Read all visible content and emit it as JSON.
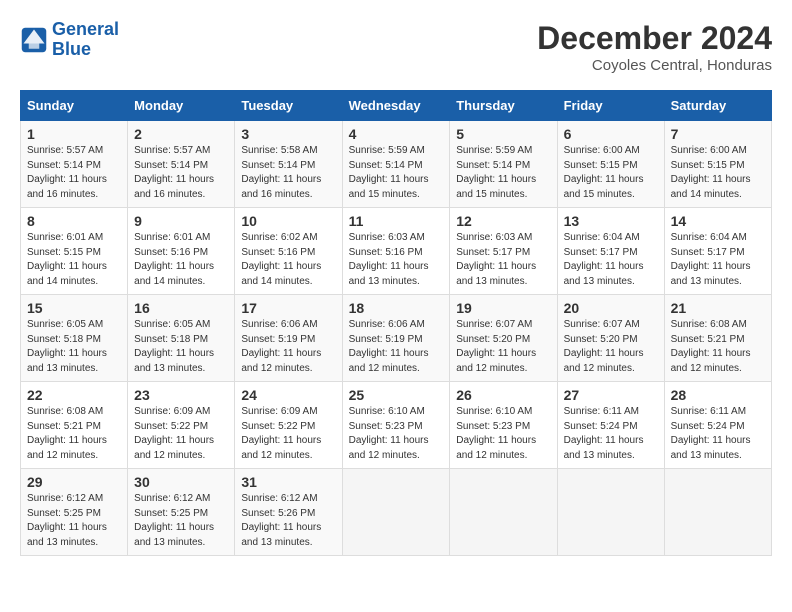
{
  "header": {
    "logo_line1": "General",
    "logo_line2": "Blue",
    "month_title": "December 2024",
    "location": "Coyoles Central, Honduras"
  },
  "weekdays": [
    "Sunday",
    "Monday",
    "Tuesday",
    "Wednesday",
    "Thursday",
    "Friday",
    "Saturday"
  ],
  "weeks": [
    [
      {
        "day": "1",
        "sunrise": "5:57 AM",
        "sunset": "5:14 PM",
        "daylight": "11 hours and 16 minutes."
      },
      {
        "day": "2",
        "sunrise": "5:57 AM",
        "sunset": "5:14 PM",
        "daylight": "11 hours and 16 minutes."
      },
      {
        "day": "3",
        "sunrise": "5:58 AM",
        "sunset": "5:14 PM",
        "daylight": "11 hours and 16 minutes."
      },
      {
        "day": "4",
        "sunrise": "5:59 AM",
        "sunset": "5:14 PM",
        "daylight": "11 hours and 15 minutes."
      },
      {
        "day": "5",
        "sunrise": "5:59 AM",
        "sunset": "5:14 PM",
        "daylight": "11 hours and 15 minutes."
      },
      {
        "day": "6",
        "sunrise": "6:00 AM",
        "sunset": "5:15 PM",
        "daylight": "11 hours and 15 minutes."
      },
      {
        "day": "7",
        "sunrise": "6:00 AM",
        "sunset": "5:15 PM",
        "daylight": "11 hours and 14 minutes."
      }
    ],
    [
      {
        "day": "8",
        "sunrise": "6:01 AM",
        "sunset": "5:15 PM",
        "daylight": "11 hours and 14 minutes."
      },
      {
        "day": "9",
        "sunrise": "6:01 AM",
        "sunset": "5:16 PM",
        "daylight": "11 hours and 14 minutes."
      },
      {
        "day": "10",
        "sunrise": "6:02 AM",
        "sunset": "5:16 PM",
        "daylight": "11 hours and 14 minutes."
      },
      {
        "day": "11",
        "sunrise": "6:03 AM",
        "sunset": "5:16 PM",
        "daylight": "11 hours and 13 minutes."
      },
      {
        "day": "12",
        "sunrise": "6:03 AM",
        "sunset": "5:17 PM",
        "daylight": "11 hours and 13 minutes."
      },
      {
        "day": "13",
        "sunrise": "6:04 AM",
        "sunset": "5:17 PM",
        "daylight": "11 hours and 13 minutes."
      },
      {
        "day": "14",
        "sunrise": "6:04 AM",
        "sunset": "5:17 PM",
        "daylight": "11 hours and 13 minutes."
      }
    ],
    [
      {
        "day": "15",
        "sunrise": "6:05 AM",
        "sunset": "5:18 PM",
        "daylight": "11 hours and 13 minutes."
      },
      {
        "day": "16",
        "sunrise": "6:05 AM",
        "sunset": "5:18 PM",
        "daylight": "11 hours and 13 minutes."
      },
      {
        "day": "17",
        "sunrise": "6:06 AM",
        "sunset": "5:19 PM",
        "daylight": "11 hours and 12 minutes."
      },
      {
        "day": "18",
        "sunrise": "6:06 AM",
        "sunset": "5:19 PM",
        "daylight": "11 hours and 12 minutes."
      },
      {
        "day": "19",
        "sunrise": "6:07 AM",
        "sunset": "5:20 PM",
        "daylight": "11 hours and 12 minutes."
      },
      {
        "day": "20",
        "sunrise": "6:07 AM",
        "sunset": "5:20 PM",
        "daylight": "11 hours and 12 minutes."
      },
      {
        "day": "21",
        "sunrise": "6:08 AM",
        "sunset": "5:21 PM",
        "daylight": "11 hours and 12 minutes."
      }
    ],
    [
      {
        "day": "22",
        "sunrise": "6:08 AM",
        "sunset": "5:21 PM",
        "daylight": "11 hours and 12 minutes."
      },
      {
        "day": "23",
        "sunrise": "6:09 AM",
        "sunset": "5:22 PM",
        "daylight": "11 hours and 12 minutes."
      },
      {
        "day": "24",
        "sunrise": "6:09 AM",
        "sunset": "5:22 PM",
        "daylight": "11 hours and 12 minutes."
      },
      {
        "day": "25",
        "sunrise": "6:10 AM",
        "sunset": "5:23 PM",
        "daylight": "11 hours and 12 minutes."
      },
      {
        "day": "26",
        "sunrise": "6:10 AM",
        "sunset": "5:23 PM",
        "daylight": "11 hours and 12 minutes."
      },
      {
        "day": "27",
        "sunrise": "6:11 AM",
        "sunset": "5:24 PM",
        "daylight": "11 hours and 13 minutes."
      },
      {
        "day": "28",
        "sunrise": "6:11 AM",
        "sunset": "5:24 PM",
        "daylight": "11 hours and 13 minutes."
      }
    ],
    [
      {
        "day": "29",
        "sunrise": "6:12 AM",
        "sunset": "5:25 PM",
        "daylight": "11 hours and 13 minutes."
      },
      {
        "day": "30",
        "sunrise": "6:12 AM",
        "sunset": "5:25 PM",
        "daylight": "11 hours and 13 minutes."
      },
      {
        "day": "31",
        "sunrise": "6:12 AM",
        "sunset": "5:26 PM",
        "daylight": "11 hours and 13 minutes."
      },
      null,
      null,
      null,
      null
    ]
  ]
}
